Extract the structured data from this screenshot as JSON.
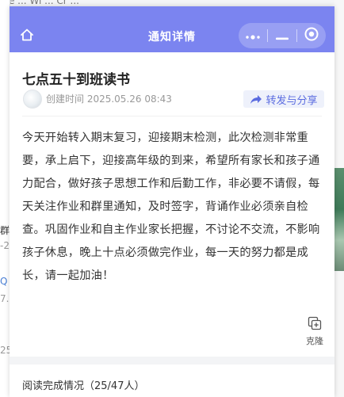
{
  "background": {
    "top_strip_text": "ste  ...  Wi  ...  Cr  ...",
    "left_snippets": [
      "群",
      "-2",
      "Q",
      "7..",
      "25"
    ]
  },
  "window": {
    "title": "通知详情",
    "titlebar_color": "#7b84f0",
    "icons": {
      "home": "home-icon",
      "more": "more-dots-icon",
      "minimize": "minimize-icon",
      "close": "close-circle-icon"
    }
  },
  "notice": {
    "title": "七点五十到班读书",
    "created": "创建时间 2025.05.26 08:43",
    "share_label": "转发与分享",
    "body": "今天开始转入期末复习，迎接期末检测，此次检测非常重要，承上启下，迎接高年级的到来，希望所有家长和孩子通力配合，做好孩子思想工作和后勤工作，非必要不请假，每天关注作业和群里通知，及时签字，背诵作业必须亲自检查。巩固作业和自主作业家长把握，不讨论不交流，不影响孩子休息，晚上十点必须做完作业，每一天的努力都是成长，请一起加油！",
    "clone_label": "克隆"
  },
  "reading": {
    "label": "阅读完成情况（25/47人）"
  },
  "colors": {
    "accent": "#5b6ce0",
    "share_bg": "#eef1fb"
  }
}
